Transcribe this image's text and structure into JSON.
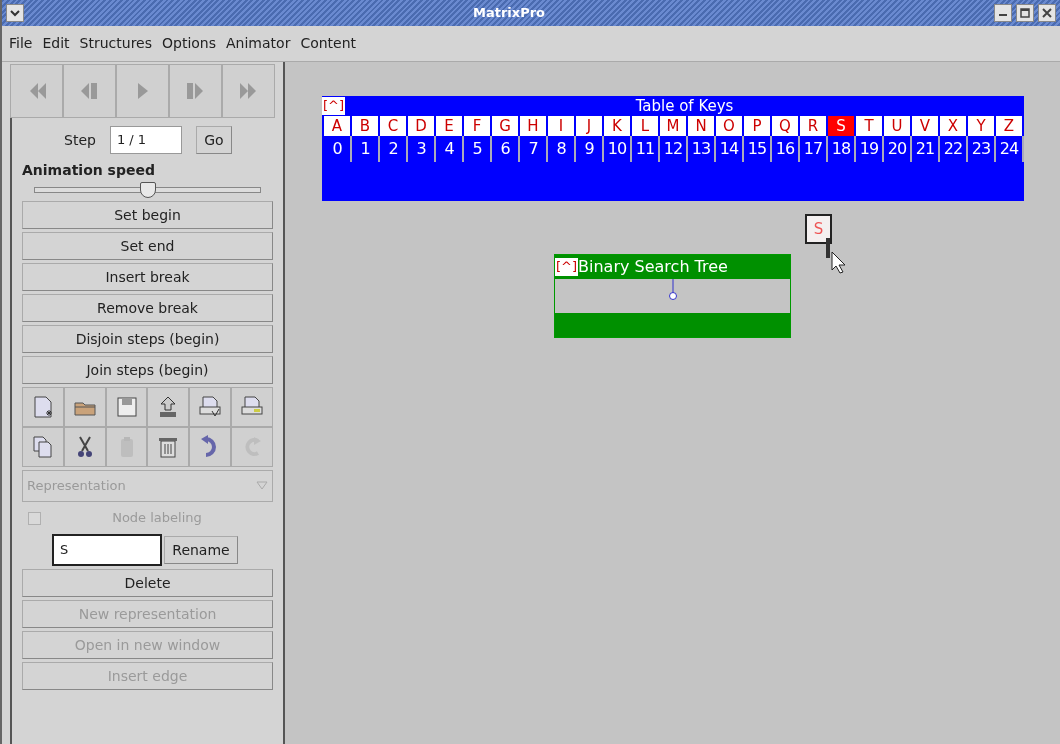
{
  "window": {
    "title": "MatrixPro"
  },
  "menu": [
    "File",
    "Edit",
    "Structures",
    "Options",
    "Animator",
    "Content"
  ],
  "media_buttons": [
    {
      "kind": "first"
    },
    {
      "kind": "back"
    },
    {
      "kind": "play"
    },
    {
      "kind": "forward"
    },
    {
      "kind": "last"
    }
  ],
  "step": {
    "label": "Step",
    "value": "1 / 1",
    "button": "Go"
  },
  "animation_speed": {
    "label": "Animation speed",
    "level": 0.5
  },
  "step_buttons": [
    "Set begin",
    "Set end",
    "Insert break",
    "Remove break",
    "Disjoin steps (begin)",
    "Join steps (begin)"
  ],
  "tools": [
    {
      "kind": "new",
      "disabled": false
    },
    {
      "kind": "open",
      "disabled": false
    },
    {
      "kind": "save",
      "disabled": false
    },
    {
      "kind": "upload",
      "disabled": false
    },
    {
      "kind": "print-preview",
      "disabled": false
    },
    {
      "kind": "print",
      "disabled": false
    },
    {
      "kind": "copy",
      "disabled": false
    },
    {
      "kind": "cut",
      "disabled": false
    },
    {
      "kind": "paste",
      "disabled": true
    },
    {
      "kind": "delete",
      "disabled": false
    },
    {
      "kind": "undo",
      "disabled": false
    },
    {
      "kind": "redo",
      "disabled": true
    }
  ],
  "representation": {
    "label": "Representation",
    "disabled": true
  },
  "node_labeling": {
    "label": "Node labeling",
    "checked": false,
    "disabled": true
  },
  "rename": {
    "value": "S",
    "button": "Rename"
  },
  "actions": [
    {
      "label": "Delete",
      "disabled": false
    },
    {
      "label": "New representation",
      "disabled": true
    },
    {
      "label": "Open in new window",
      "disabled": true
    },
    {
      "label": "Insert edge",
      "disabled": true
    }
  ],
  "table_of_keys": {
    "handle": "[^]",
    "title": "Table of Keys",
    "keys": [
      {
        "key": "A",
        "index": "0",
        "selected": false
      },
      {
        "key": "B",
        "index": "1",
        "selected": false
      },
      {
        "key": "C",
        "index": "2",
        "selected": false
      },
      {
        "key": "D",
        "index": "3",
        "selected": false
      },
      {
        "key": "E",
        "index": "4",
        "selected": false
      },
      {
        "key": "F",
        "index": "5",
        "selected": false
      },
      {
        "key": "G",
        "index": "6",
        "selected": false
      },
      {
        "key": "H",
        "index": "7",
        "selected": false
      },
      {
        "key": "I",
        "index": "8",
        "selected": false
      },
      {
        "key": "J",
        "index": "9",
        "selected": false
      },
      {
        "key": "K",
        "index": "10",
        "selected": false
      },
      {
        "key": "L",
        "index": "11",
        "selected": false
      },
      {
        "key": "M",
        "index": "12",
        "selected": false
      },
      {
        "key": "N",
        "index": "13",
        "selected": false
      },
      {
        "key": "O",
        "index": "14",
        "selected": false
      },
      {
        "key": "P",
        "index": "15",
        "selected": false
      },
      {
        "key": "Q",
        "index": "16",
        "selected": false
      },
      {
        "key": "R",
        "index": "17",
        "selected": false
      },
      {
        "key": "S",
        "index": "18",
        "selected": true
      },
      {
        "key": "T",
        "index": "19",
        "selected": false
      },
      {
        "key": "U",
        "index": "20",
        "selected": false
      },
      {
        "key": "V",
        "index": "21",
        "selected": false
      },
      {
        "key": "X",
        "index": "22",
        "selected": false
      },
      {
        "key": "Y",
        "index": "23",
        "selected": false
      },
      {
        "key": "Z",
        "index": "24",
        "selected": false
      }
    ]
  },
  "binary_search_tree": {
    "handle": "[^]",
    "title": "Binary Search Tree"
  },
  "dragged_key": {
    "key": "S"
  }
}
